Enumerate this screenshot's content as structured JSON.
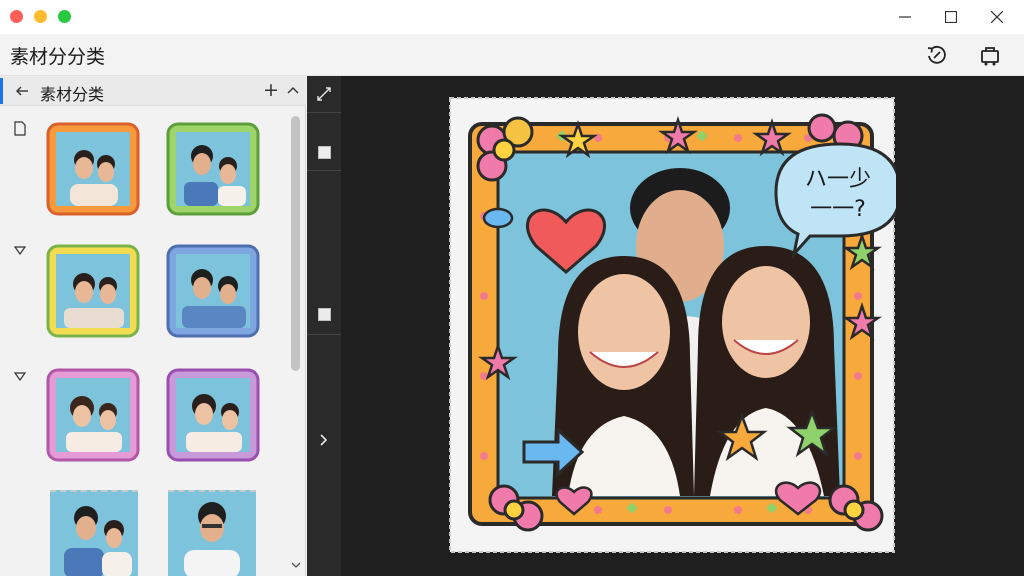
{
  "window": {
    "controls": [
      "minimize-icon",
      "maximize-icon",
      "close-icon"
    ]
  },
  "header": {
    "title": "素材分分类",
    "icons": [
      "sync-icon",
      "cart-icon"
    ]
  },
  "panel": {
    "title": "素材分类",
    "icons": [
      "back-arrow-icon",
      "add-icon",
      "chevron-up-icon",
      "file-icon",
      "triangle-down-icon",
      "scroll-down-icon"
    ]
  },
  "toolstrip": {
    "icons": [
      "swap-icon",
      "square-tool-icon",
      "expand-arrow-icon"
    ]
  },
  "canvas": {
    "speech_bubble_text_line1": "ハ一少",
    "speech_bubble_text_line2": "一一?"
  },
  "colors": {
    "accent_blue": "#1a73e8",
    "dark_canvas": "#1f1f1f",
    "photo_background": "#7ec3dc",
    "frame_orange": "#f7a93c"
  }
}
